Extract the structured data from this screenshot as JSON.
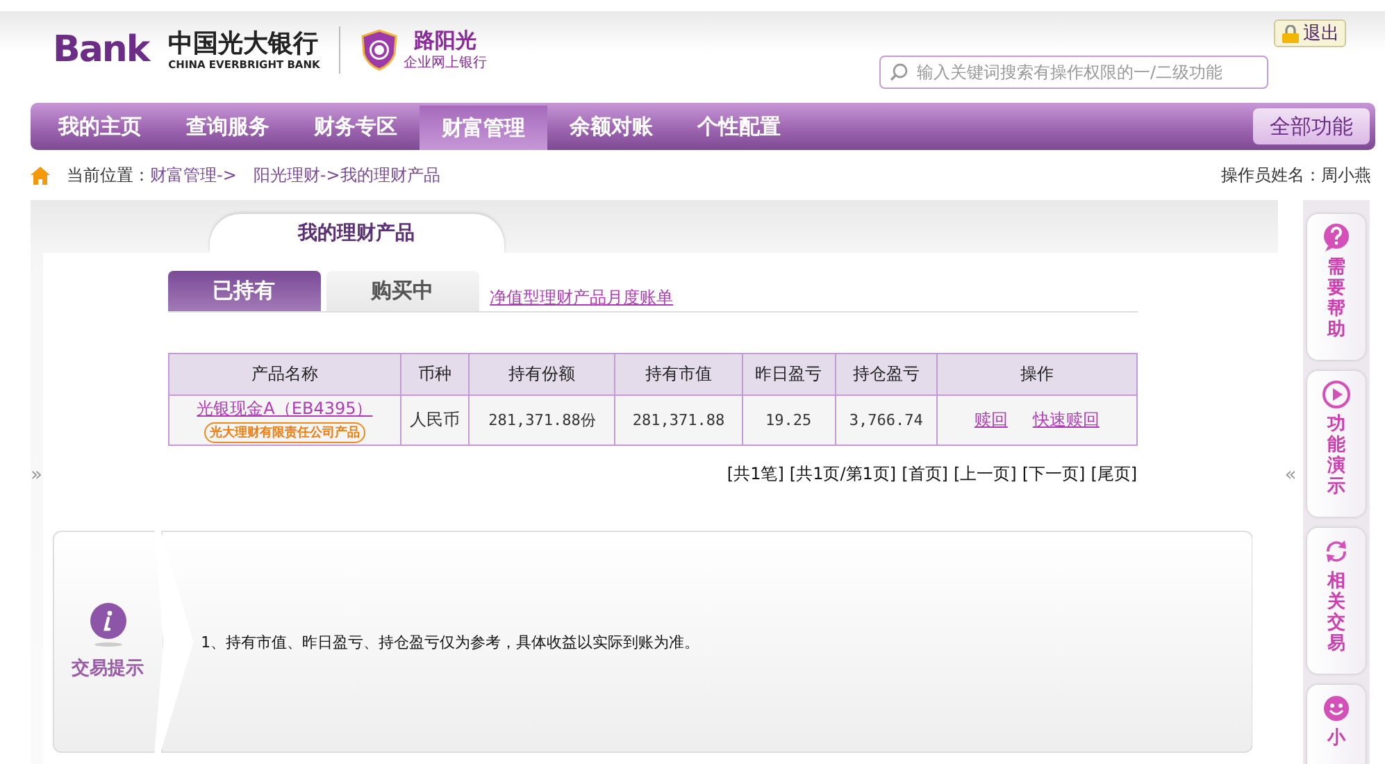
{
  "header": {
    "logo": {
      "mark": "Bank",
      "name": "中国光大银行",
      "english": "CHINA EVERBRIGHT BANK"
    },
    "sub_logo": {
      "name": "路阳光",
      "caption": "企业网上银行"
    },
    "logout": "退出",
    "search": {
      "placeholder": "输入关键词搜索有操作权限的一/二级功能"
    }
  },
  "nav": {
    "items": [
      {
        "label": "我的主页",
        "selected": false
      },
      {
        "label": "查询服务",
        "selected": false
      },
      {
        "label": "财务专区",
        "selected": false
      },
      {
        "label": "财富管理",
        "selected": true
      },
      {
        "label": "余额对账",
        "selected": false
      },
      {
        "label": "个性配置",
        "selected": false
      }
    ],
    "all_button": "全部功能"
  },
  "breadcrumb": {
    "label": "当前位置：",
    "links": [
      "财富管理->",
      "阳光理财->我的理财产品"
    ],
    "operator": "操作员姓名：周小燕"
  },
  "page_tab": "我的理财产品",
  "sub_tabs": [
    {
      "label": "已持有",
      "selected": true
    },
    {
      "label": "购买中",
      "selected": false
    }
  ],
  "statement_link": "净值型理财产品月度账单",
  "table": {
    "columns": [
      "产品名称",
      "币种",
      "持有份额",
      "持有市值",
      "昨日盈亏",
      "持仓盈亏",
      "操作"
    ],
    "rows": [
      {
        "product": "光银现金A（EB4395）",
        "issuer_tag": "光大理财有限责任公司产品",
        "currency": "人民币",
        "shares": "281,371.88份",
        "market_value": "281,371.88",
        "yesterday_pl": "19.25",
        "position_pl": "3,766.74",
        "actions": [
          "赎回",
          "快速赎回"
        ]
      }
    ]
  },
  "pager": [
    "[共1笔]",
    "[共1页/第1页]",
    "[首页]",
    "[上一页]",
    "[下一页]",
    "[尾页]"
  ],
  "left_toggle": "»",
  "right_toggle": "«",
  "tip": {
    "title": "交易提示",
    "text": "1、持有市值、昨日盈亏、持仓盈亏仅为参考，具体收益以实际到账为准。"
  },
  "side_panel": [
    {
      "kind": "help",
      "label": "需要帮助"
    },
    {
      "kind": "demo",
      "label": "功能演示"
    },
    {
      "kind": "related",
      "label": "相关交易"
    },
    {
      "kind": "tips",
      "label": "小"
    }
  ]
}
